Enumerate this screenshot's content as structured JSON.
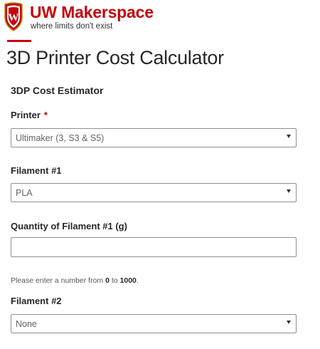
{
  "brand": {
    "title": "UW Makerspace",
    "tagline": "where limits don't exist",
    "crest_letter": "W",
    "accent_color": "#c5050c"
  },
  "page_title": "3D Printer Cost Calculator",
  "form": {
    "heading": "3DP Cost Estimator",
    "printer": {
      "label": "Printer",
      "required_mark": "*",
      "selected": "Ultimaker (3, S3 & S5)"
    },
    "filament1": {
      "label": "Filament #1",
      "selected": "PLA"
    },
    "quantity1": {
      "label": "Quantity of Filament #1 (g)",
      "value": "",
      "help_prefix": "Please enter a number from ",
      "help_min": "0",
      "help_mid": " to ",
      "help_max": "1000",
      "help_suffix": "."
    },
    "filament2": {
      "label": "Filament #2",
      "selected": "None"
    }
  },
  "icons": {
    "crest": "uw-crest-icon",
    "dropdown": "chevron-down-icon"
  }
}
